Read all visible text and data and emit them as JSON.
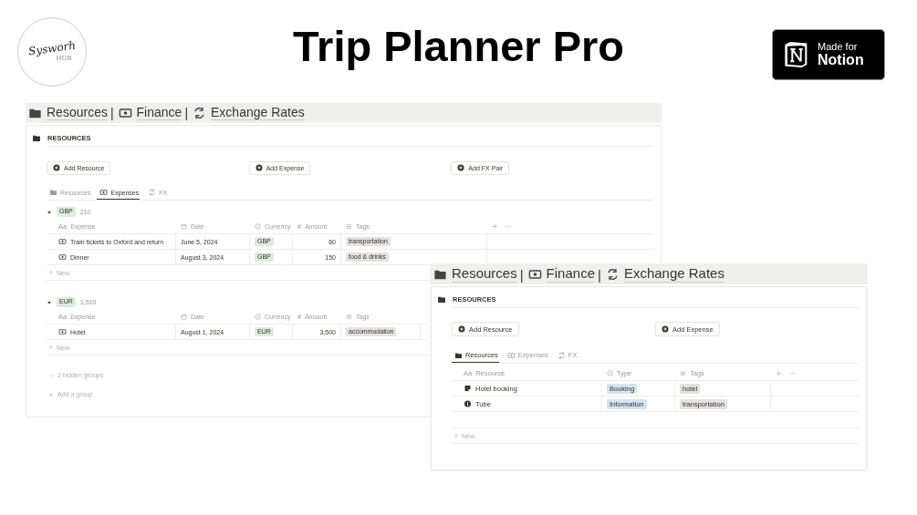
{
  "header": {
    "logo": {
      "script": "Sysworh",
      "sub": "HUB"
    },
    "title": "Trip Planner Pro",
    "badge": {
      "line1": "Made for",
      "line2": "Notion"
    }
  },
  "panels": [
    {
      "breadcrumb": [
        {
          "label": "Resources",
          "sep": "|"
        },
        {
          "label": "Finance",
          "sep": "|"
        },
        {
          "label": "Exchange Rates"
        }
      ],
      "section": "RESOURCES",
      "buttons": [
        {
          "label": "Add Resource"
        },
        {
          "label": "Add Expense"
        },
        {
          "label": "Add FX Pair"
        }
      ],
      "tabs": [
        {
          "label": "Resources",
          "selected": false
        },
        {
          "label": "Expenses",
          "selected": true
        },
        {
          "label": "FX",
          "selected": false
        }
      ],
      "groups": [
        {
          "name": "GBP",
          "total": "210",
          "expanded": true,
          "table": {
            "header_actions": true,
            "columns": [
              {
                "kind": "title",
                "prefix": "Aa",
                "label": "Expense"
              },
              {
                "kind": "date",
                "label": "Date"
              },
              {
                "kind": "select",
                "label": "Currency"
              },
              {
                "kind": "number",
                "prefix": "#",
                "label": "Amount"
              },
              {
                "kind": "multi",
                "label": "Tags"
              }
            ],
            "rows": [
              {
                "kind": "expense",
                "cells": [
                  "Train tickets to Oxford and return",
                  "June 5, 2024",
                  "GBP",
                  "60",
                  "transportation"
                ]
              },
              {
                "kind": "expense",
                "cells": [
                  "Dinner",
                  "August 3, 2024",
                  "GBP",
                  "150",
                  "food & drinks"
                ]
              }
            ],
            "new": "New"
          }
        },
        {
          "name": "EUR",
          "total": "3,500",
          "expanded": true,
          "table": {
            "columns": [
              {
                "kind": "title",
                "prefix": "Aa",
                "label": "Expense"
              },
              {
                "kind": "date",
                "label": "Date"
              },
              {
                "kind": "select",
                "label": "Currency"
              },
              {
                "kind": "number",
                "prefix": "#",
                "label": "Amount"
              },
              {
                "kind": "multi",
                "label": "Tags"
              }
            ],
            "rows": [
              {
                "kind": "expense",
                "cells": [
                  "Hotel",
                  "August 1, 2024",
                  "EUR",
                  "3,500",
                  "accommodation"
                ]
              }
            ],
            "new": "New"
          }
        }
      ],
      "hidden_groups": "2 hidden groups",
      "add_group": "Add a group"
    },
    {
      "breadcrumb": [
        {
          "label": "Resources",
          "sep": "|"
        },
        {
          "label": "Finance",
          "sep": "|"
        },
        {
          "label": "Exchange Rates"
        }
      ],
      "section": "RESOURCES",
      "buttons": [
        {
          "label": "Add Resource"
        },
        {
          "label": "Add Expense"
        }
      ],
      "tabs": [
        {
          "label": "Resources",
          "selected": true
        },
        {
          "label": "Expenses",
          "selected": false
        },
        {
          "label": "FX",
          "selected": false
        }
      ],
      "table": {
        "header_actions": true,
        "columns": [
          {
            "kind": "title",
            "prefix": "Aa",
            "label": "Resource"
          },
          {
            "kind": "select",
            "label": "Type"
          },
          {
            "kind": "multi",
            "label": "Tags"
          }
        ],
        "rows": [
          {
            "kind": "note",
            "cells": [
              "Hotel booking",
              "Booking",
              "hotel"
            ]
          },
          {
            "kind": "info",
            "cells": [
              "Tube",
              "Information",
              "transportation"
            ]
          }
        ],
        "new": "New"
      }
    }
  ]
}
